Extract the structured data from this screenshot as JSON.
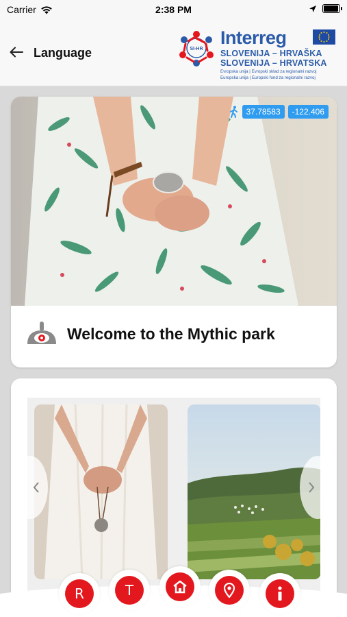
{
  "status_bar": {
    "carrier": "Carrier",
    "time": "2:38 PM",
    "battery_level": 0.95
  },
  "header": {
    "title": "Language",
    "back_icon": "arrow-left-icon",
    "logo": {
      "mark_text": "SI-HR",
      "word": "Interreg",
      "line1": "SLOVENIJA – HRVAŠKA",
      "line2": "SLOVENIJA – HRVATSKA",
      "small1": "Evropska unija  |  Evropski sklad za regionalni razvoj",
      "small2": "Europska unija  |  Europski fond za regionalni razvoj",
      "colors": {
        "blue": "#2b5ba8",
        "red": "#e3181f"
      }
    }
  },
  "hero": {
    "latitude": "37.78583",
    "longitude": "-122.406",
    "walk_icon": "walking-person-icon",
    "title": "Welcome to the Mythic park",
    "caption_icon": "eye-mound-icon"
  },
  "gallery": {
    "prev_icon": "chevron-left-icon",
    "next_icon": "chevron-right-icon"
  },
  "bottom_nav": {
    "items": [
      {
        "label": "R",
        "icon": null
      },
      {
        "label": "T",
        "icon": null
      },
      {
        "label": "",
        "icon": "home-icon"
      },
      {
        "label": "",
        "icon": "map-pin-icon"
      },
      {
        "label": "",
        "icon": "info-icon"
      }
    ],
    "accent": "#e3181f"
  }
}
